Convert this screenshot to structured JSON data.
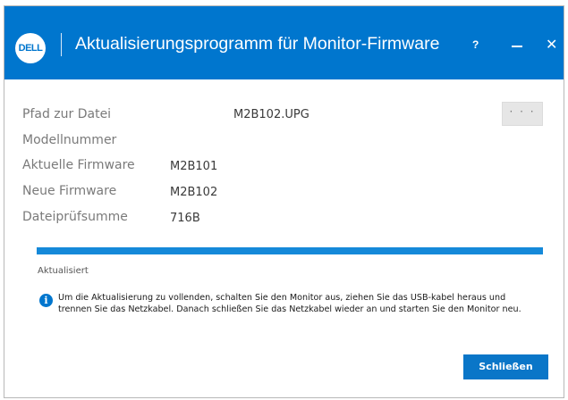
{
  "window": {
    "title": "Aktualisierungsprogramm für Monitor-Firmware",
    "logo_text": "DELL",
    "help_label": "?",
    "close_label": "✕",
    "accent_color": "#0076ce"
  },
  "fields": {
    "file_path": {
      "label": "Pfad zur Datei",
      "value": "M2B102.UPG"
    },
    "model_number": {
      "label": "Modellnummer",
      "value": ""
    },
    "current_firmware": {
      "label": "Aktuelle Firmware",
      "value": "M2B101"
    },
    "new_firmware": {
      "label": "Neue Firmware",
      "value": "M2B102"
    },
    "checksum": {
      "label": "Dateiprüfsumme",
      "value": "716B"
    }
  },
  "browse_button": {
    "label": "· · ·"
  },
  "progress": {
    "percent": 100,
    "status": "Aktualisiert"
  },
  "info": {
    "line1": "Um die Aktualisierung zu vollenden, schalten Sie den Monitor aus, ziehen Sie das USB-kabel heraus und",
    "line2": "trennen Sie das Netzkabel. Danach schließen Sie das Netzkabel wieder an und starten Sie den Monitor neu.",
    "icon": "info-icon"
  },
  "footer": {
    "close_button": "Schließen"
  }
}
